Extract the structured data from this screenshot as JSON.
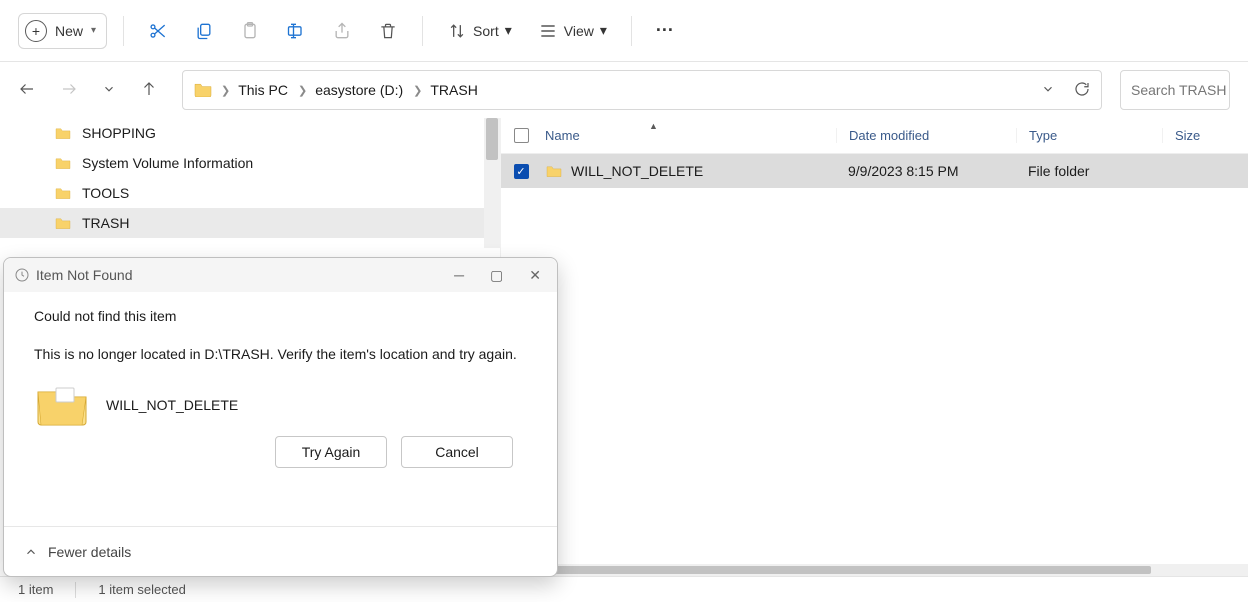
{
  "toolbar": {
    "new_label": "New",
    "sort_label": "Sort",
    "view_label": "View"
  },
  "breadcrumb": {
    "items": [
      "This PC",
      "easystore (D:)",
      "TRASH"
    ]
  },
  "search": {
    "placeholder": "Search TRASH"
  },
  "sidebar": {
    "items": [
      {
        "label": "SHOPPING"
      },
      {
        "label": "System Volume Information"
      },
      {
        "label": "TOOLS"
      },
      {
        "label": "TRASH",
        "selected": true
      }
    ]
  },
  "columns": {
    "name": "Name",
    "date": "Date modified",
    "type": "Type",
    "size": "Size"
  },
  "rows": [
    {
      "name": "WILL_NOT_DELETE",
      "date": "9/9/2023 8:15 PM",
      "type": "File folder",
      "checked": true
    }
  ],
  "status": {
    "count": "1 item",
    "selected": "1 item selected"
  },
  "dialog": {
    "title": "Item Not Found",
    "msg1": "Could not find this item",
    "msg2": "This is no longer located in D:\\TRASH. Verify the item's location and try again.",
    "item_name": "WILL_NOT_DELETE",
    "try_again": "Try Again",
    "cancel": "Cancel",
    "fewer": "Fewer details"
  }
}
